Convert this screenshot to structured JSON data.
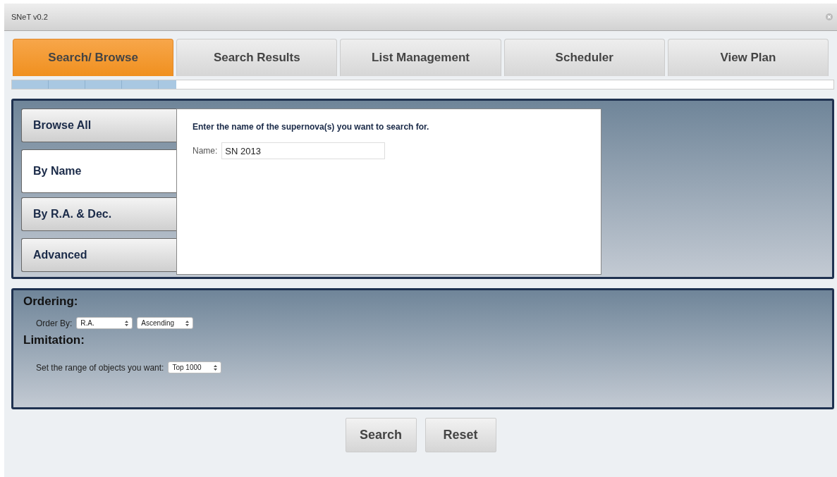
{
  "window": {
    "title": "SNeT v0.2"
  },
  "tabs": [
    {
      "label": "Search/ Browse",
      "selected": true
    },
    {
      "label": "Search Results",
      "selected": false
    },
    {
      "label": "List Management",
      "selected": false
    },
    {
      "label": "Scheduler",
      "selected": false
    },
    {
      "label": "View Plan",
      "selected": false
    }
  ],
  "progress": {
    "level": 0.2
  },
  "search_modes": [
    {
      "label": "Browse All",
      "selected": false
    },
    {
      "label": "By Name",
      "selected": true
    },
    {
      "label": "By R.A. & Dec.",
      "selected": false
    },
    {
      "label": "Advanced",
      "selected": false
    }
  ],
  "search_panel": {
    "instruction": "Enter the name of the supernova(s) you want to search for.",
    "name_label": "Name:",
    "name_value": "SN 2013"
  },
  "ordering": {
    "heading": "Ordering:",
    "label": "Order By:",
    "selects": [
      "R.A.",
      "Ascending"
    ]
  },
  "limitation": {
    "heading": "Limitation:",
    "label": "Set the range of objects you want:",
    "select": "Top 1000"
  },
  "buttons": [
    "Search",
    "Reset"
  ]
}
